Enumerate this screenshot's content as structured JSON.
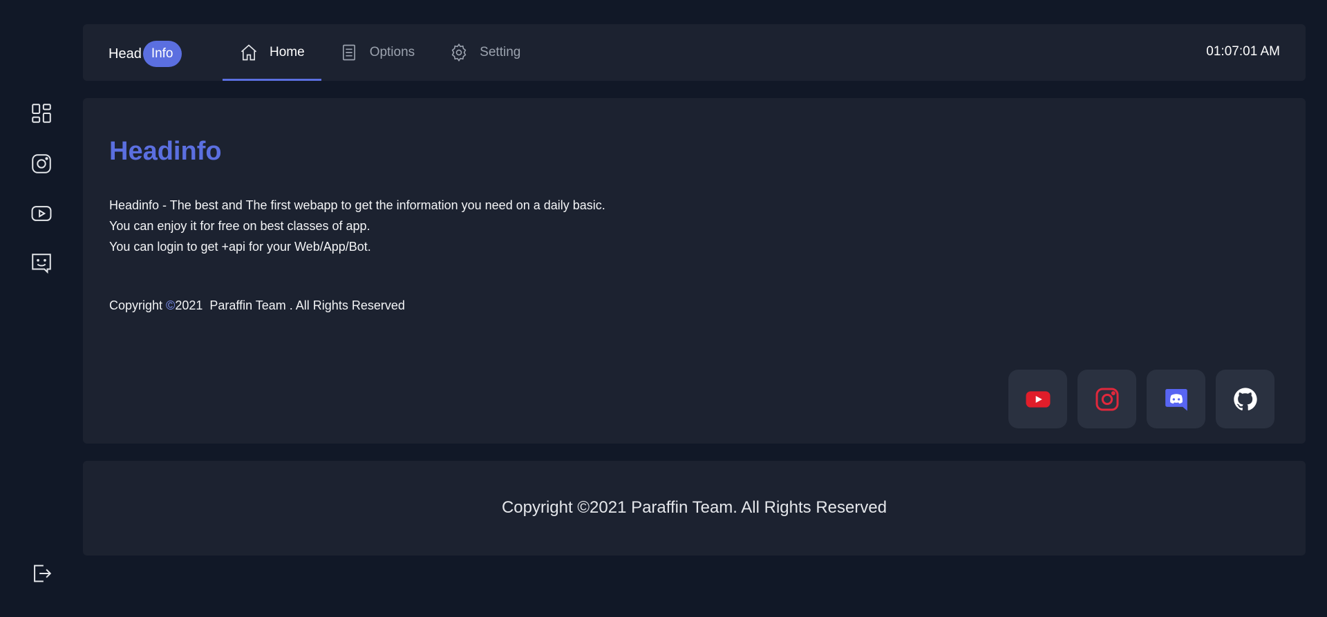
{
  "brand": {
    "text": "Head",
    "pill": "Info"
  },
  "nav": {
    "items": [
      {
        "label": "Home",
        "icon": "home-icon",
        "active": true
      },
      {
        "label": "Options",
        "icon": "document-icon",
        "active": false
      },
      {
        "label": "Setting",
        "icon": "gear-icon",
        "active": false
      }
    ]
  },
  "clock": "01:07:01 AM",
  "sidebar": {
    "icons": [
      "dashboard-icon",
      "instagram-icon",
      "youtube-icon",
      "chat-bot-icon"
    ],
    "logout_icon": "logout-icon"
  },
  "main": {
    "title": "Headinfo",
    "lines": [
      "Headinfo - The best and The first webapp to get the information you need on a daily basic.",
      "You can enjoy it for free on best classes of app.",
      "You can login to get +api for your Web/App/Bot."
    ],
    "copyright": {
      "prefix": "Copyright ",
      "symbol": "©",
      "year": "2021",
      "team": "Paraffin Team",
      "suffix": " . All Rights Reserved"
    }
  },
  "social": [
    {
      "name": "youtube",
      "color": "#e11d2a"
    },
    {
      "name": "instagram",
      "color": "#e0283c"
    },
    {
      "name": "discord",
      "color": "#5865f2"
    },
    {
      "name": "github",
      "color": "#ffffff"
    }
  ],
  "footer": {
    "text": "Copyright ©2021 Paraffin Team. All Rights Reserved"
  },
  "colors": {
    "accent": "#5b6fe0",
    "background": "#111827",
    "panel": "#1c2230"
  }
}
